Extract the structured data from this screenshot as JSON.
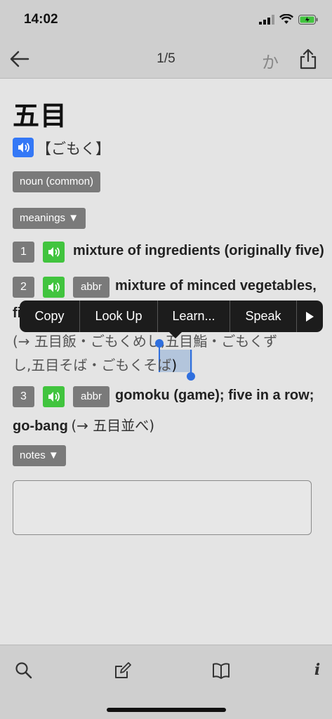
{
  "status": {
    "time": "14:02"
  },
  "nav": {
    "counter": "1/5",
    "kana_label": "か"
  },
  "entry": {
    "headword": "五目",
    "reading": "【ごもく】",
    "pos_tag": "noun (common)",
    "meanings_toggle": "meanings ▼",
    "senses": [
      {
        "num": "1",
        "gloss": "mixture of ingredients (originally five)"
      },
      {
        "num": "2",
        "tag": "abbr",
        "gloss_line1": "mixture of minced vegetables,",
        "gloss_line2_partial": "fi",
        "xref_line1": "(→ 五目飯・ごもくめし,五目鮨・ごもくず",
        "xref_line2_pre": "し,五目そば・ごもく",
        "xref_selected": "そば",
        "xref_line2_post": ")"
      },
      {
        "num": "3",
        "tag": "abbr",
        "gloss_line1": "gomoku (game); five in a row;",
        "gloss_line2": "go-bang",
        "xref": "(→ 五目並べ)"
      }
    ],
    "notes_toggle": "notes ▼"
  },
  "context_menu": {
    "items": [
      "Copy",
      "Look Up",
      "Learn...",
      "Speak"
    ]
  },
  "colors": {
    "speaker_blue": "#3478f6",
    "speaker_green": "#41c43e",
    "selection": "#2f6fde"
  },
  "tabs": {
    "icons": [
      "search-icon",
      "edit-icon",
      "book-icon",
      "info-icon"
    ],
    "info_glyph": "i"
  }
}
